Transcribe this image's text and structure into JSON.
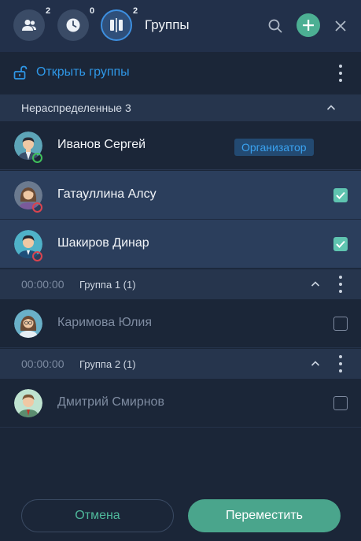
{
  "header": {
    "users_count": "2",
    "history_count": "0",
    "groups_count": "2",
    "title": "Группы"
  },
  "open_groups": {
    "label": "Открыть группы"
  },
  "unassigned": {
    "label": "Нераспределенные 3",
    "members": [
      {
        "name": "Иванов Сергей",
        "badge": "Организатор",
        "status": "online",
        "checked": null
      },
      {
        "name": "Гатауллина Алсу",
        "status": "offline",
        "checked": true
      },
      {
        "name": "Шакиров Динар",
        "status": "offline",
        "checked": true
      }
    ]
  },
  "groups": [
    {
      "time": "00:00:00",
      "name": "Группа 1 (1)",
      "members": [
        {
          "name": "Каримова Юлия",
          "checked": false
        }
      ]
    },
    {
      "time": "00:00:00",
      "name": "Группа 2 (1)",
      "members": [
        {
          "name": "Дмитрий Смирнов",
          "checked": false
        }
      ]
    }
  ],
  "footer": {
    "cancel_label": "Отмена",
    "move_label": "Переместить"
  },
  "colors": {
    "accent": "#4aa58c",
    "link": "#2f98e8",
    "online": "#3fbf5a",
    "offline": "#d9444f"
  }
}
